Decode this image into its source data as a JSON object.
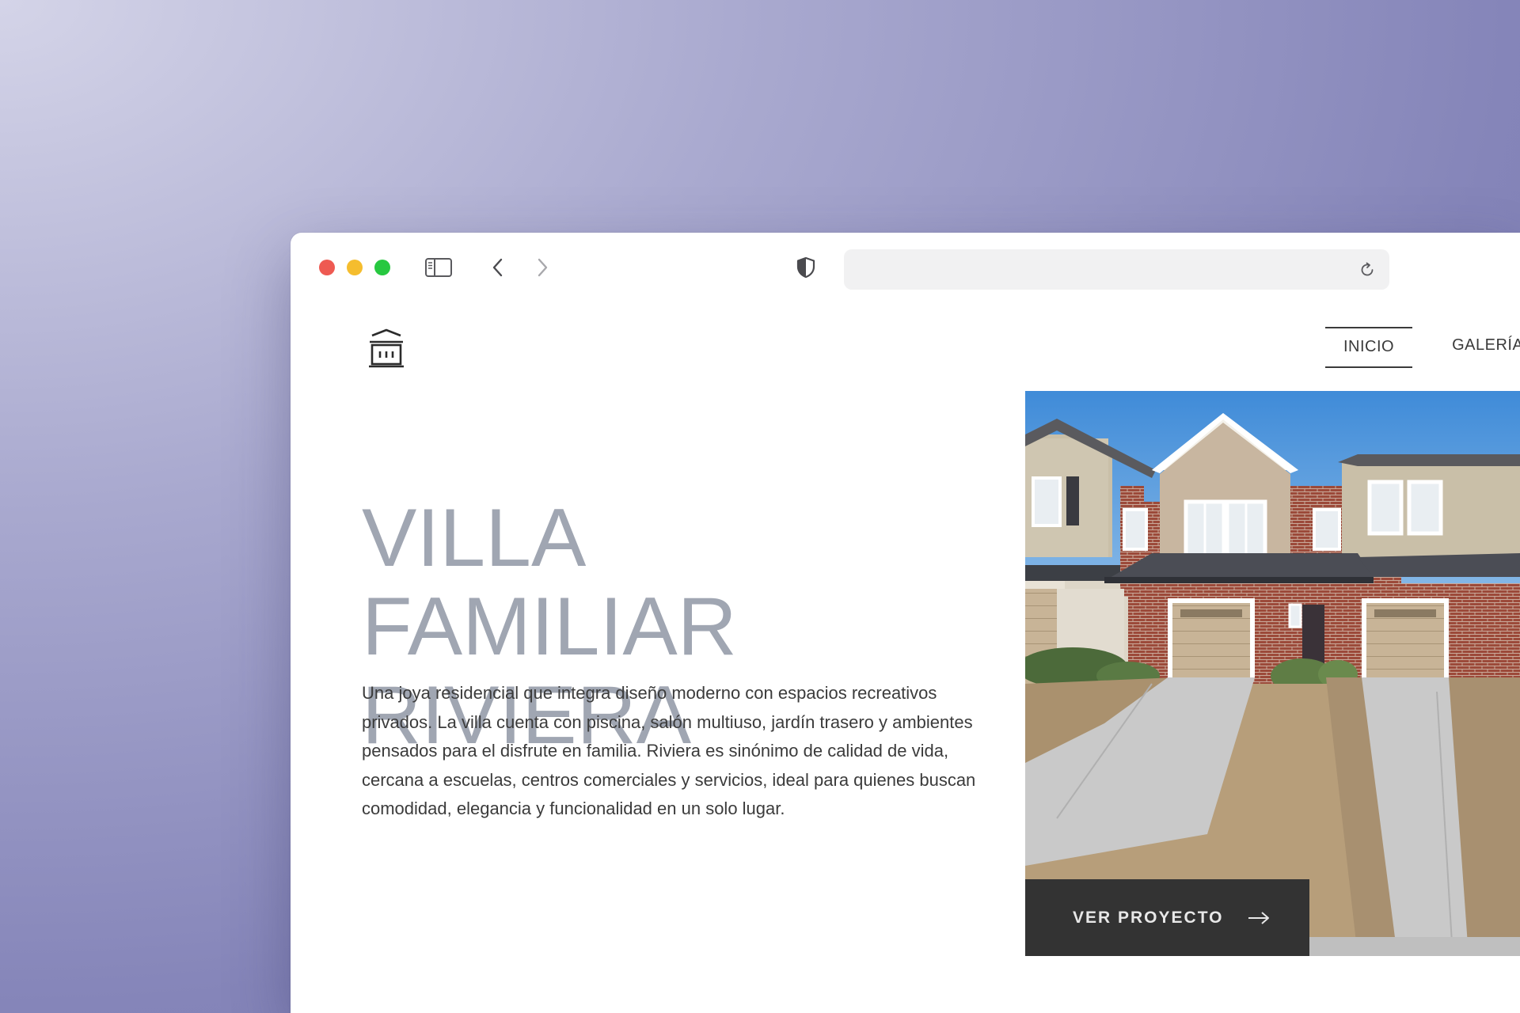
{
  "browser": {
    "url": ""
  },
  "nav": {
    "items": [
      {
        "label": "INICIO",
        "active": true
      },
      {
        "label": "GALERÍA",
        "active": false
      }
    ]
  },
  "hero": {
    "title_line1": "VILLA FAMILIAR",
    "title_line2": "RIVIERA",
    "description": "Una joya residencial que integra diseño moderno con espacios recreativos privados. La villa cuenta con piscina, salón multiuso, jardín trasero y ambientes pensados para el disfrute en familia. Riviera es sinónimo de calidad de vida, cercana a escuelas, centros comerciales y servicios, ideal para quienes buscan comodidad, elegancia y funcionalidad en un solo lugar.",
    "cta_label": "VER PROYECTO"
  },
  "icons": {
    "logo": "bank-building-icon",
    "sidebar": "sidebar-icon",
    "back": "chevron-left-icon",
    "forward": "chevron-right-icon",
    "privacy": "shield-icon",
    "reload": "reload-icon",
    "cta": "arrow-right-icon"
  },
  "colors": {
    "traffic_red": "#ee5a52",
    "traffic_yellow": "#f5bd2e",
    "traffic_green": "#27c840",
    "hero_title": "#a0a6b2",
    "cta_background": "#333333"
  }
}
